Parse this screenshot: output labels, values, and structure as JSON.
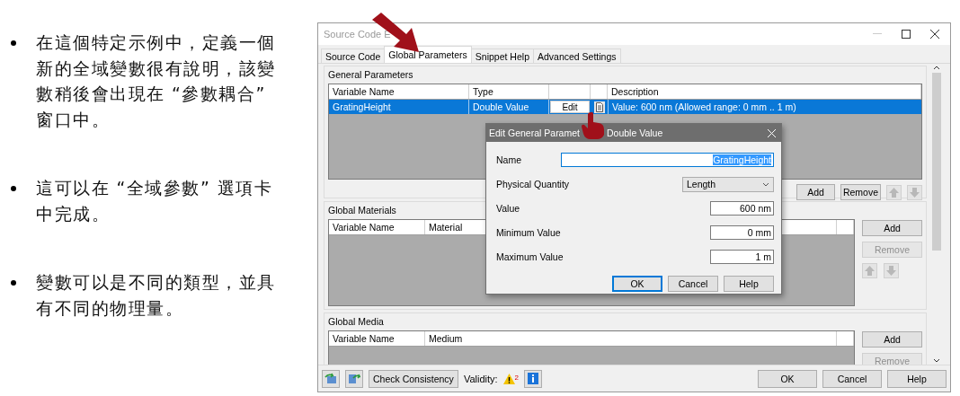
{
  "bullets": [
    {
      "text": "在這個特定示例中，定義一個新的全域變數很有說明，該變數稍後會出現在 “參數耦合” 窗口中。"
    },
    {
      "text": "這可以在 “全域參數” 選項卡中完成。"
    },
    {
      "text": "變數可以是不同的類型，並具有不同的物理量。"
    }
  ],
  "window": {
    "title": "Source Code E",
    "tabs": [
      {
        "label": "Source Code",
        "selected": false
      },
      {
        "label": "Global Parameters",
        "selected": true
      },
      {
        "label": "Snippet Help",
        "selected": false
      },
      {
        "label": "Advanced Settings",
        "selected": false
      }
    ],
    "general_parameters": {
      "title": "General Parameters",
      "columns": [
        "Variable Name",
        "Type",
        "Description"
      ],
      "rows": [
        {
          "variable_name": "GratingHeight",
          "type": "Double Value",
          "edit_button": "Edit",
          "description": "Value: 600 nm (Allowed range: 0 mm .. 1 m)",
          "selected": true
        }
      ],
      "buttons": [
        {
          "label": "Add",
          "disabled": false
        },
        {
          "label": "Remove",
          "disabled": false
        }
      ]
    },
    "global_materials": {
      "title": "Global Materials",
      "columns": [
        "Variable Name",
        "Material"
      ],
      "buttons": [
        {
          "label": "Add",
          "disabled": false
        },
        {
          "label": "Remove",
          "disabled": true
        }
      ]
    },
    "global_media": {
      "title": "Global Media",
      "columns": [
        "Variable Name",
        "Medium"
      ],
      "buttons": [
        {
          "label": "Add",
          "disabled": false
        },
        {
          "label": "Remove",
          "disabled": true
        }
      ]
    },
    "footer": {
      "check_button": "Check Consistency",
      "validity_label": "Validity:",
      "warning_count": "2",
      "buttons": [
        "OK",
        "Cancel",
        "Help"
      ]
    }
  },
  "dialog": {
    "title_start": "Edit General Paramet",
    "title_end": "Double Value",
    "fields": [
      {
        "kind": "text",
        "label": "Name",
        "value": "GratingHeight",
        "text_selected": true
      },
      {
        "kind": "dropdown",
        "label": "Physical Quantity",
        "value": "Length"
      },
      {
        "kind": "number",
        "label": "Value",
        "value": "600 nm"
      },
      {
        "kind": "number",
        "label": "Minimum Value",
        "value": "0 mm"
      },
      {
        "kind": "number",
        "label": "Maximum Value",
        "value": "1 m"
      }
    ],
    "buttons": [
      {
        "label": "OK",
        "default": true
      },
      {
        "label": "Cancel",
        "default": false
      },
      {
        "label": "Help",
        "default": false
      }
    ]
  }
}
